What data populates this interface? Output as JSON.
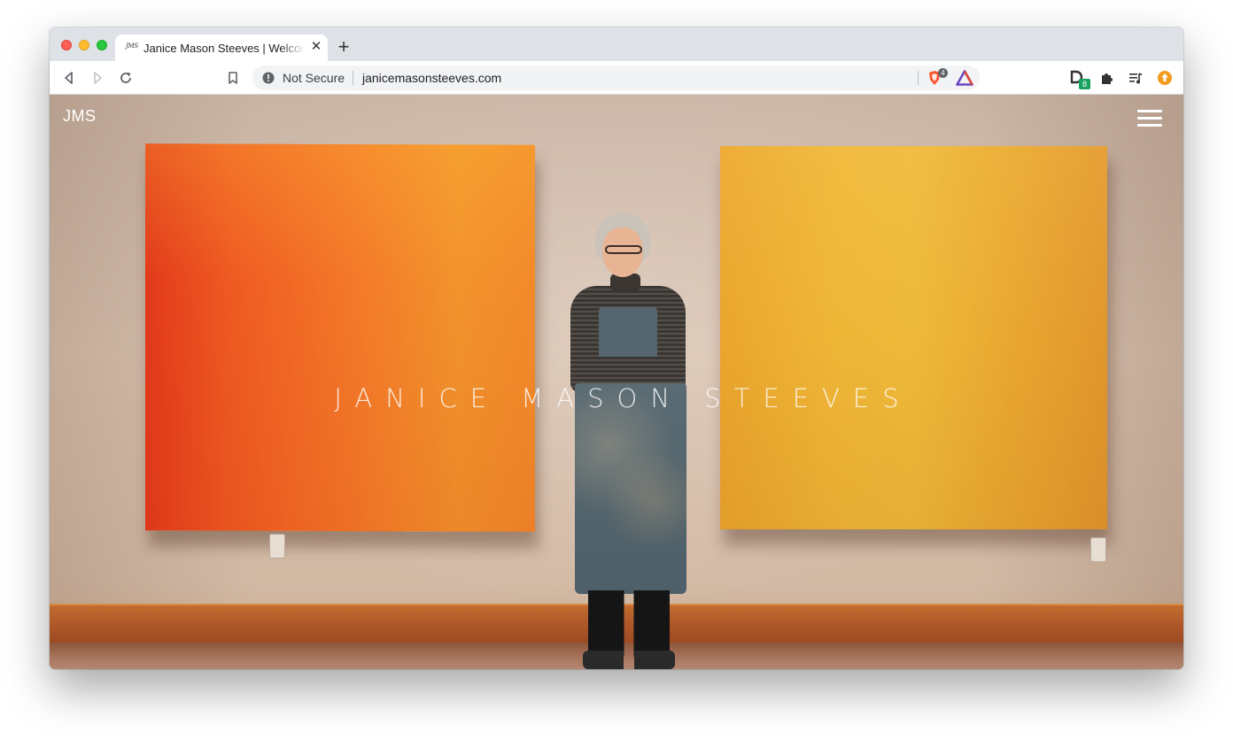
{
  "browser": {
    "tab": {
      "favicon_text": "JMS",
      "title": "Janice Mason Steeves | Welcome"
    },
    "new_tab_label": "+",
    "omnibox": {
      "security_label": "Not Secure",
      "url": "janicemasonsteeves.com",
      "shield_count": "4"
    },
    "extensions": {
      "d_badge": "8"
    }
  },
  "site": {
    "logo": "JMS",
    "hero_title": "JANICE MASON STEEVES"
  },
  "colors": {
    "painting_left": "#f0612a",
    "painting_right": "#ebae34",
    "wall": "#d8c2b0",
    "baseboard": "#b0592a"
  }
}
